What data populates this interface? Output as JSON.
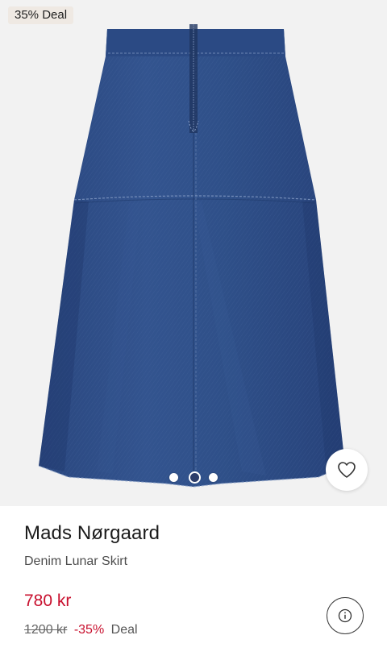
{
  "badge": {
    "text": "35% Deal"
  },
  "product": {
    "brand": "Mads Nørgaard",
    "name": "Denim Lunar Skirt",
    "price": "780 kr",
    "old_price": "1200 kr",
    "discount": "-35%",
    "deal_label": "Deal"
  },
  "carousel": {
    "total": 3,
    "active_index": 1
  },
  "icons": {
    "wishlist": "heart-icon",
    "info": "info-icon"
  },
  "colors": {
    "price": "#c8102e",
    "badge_bg": "#efe9e3",
    "denim": "#2e4f8a"
  }
}
